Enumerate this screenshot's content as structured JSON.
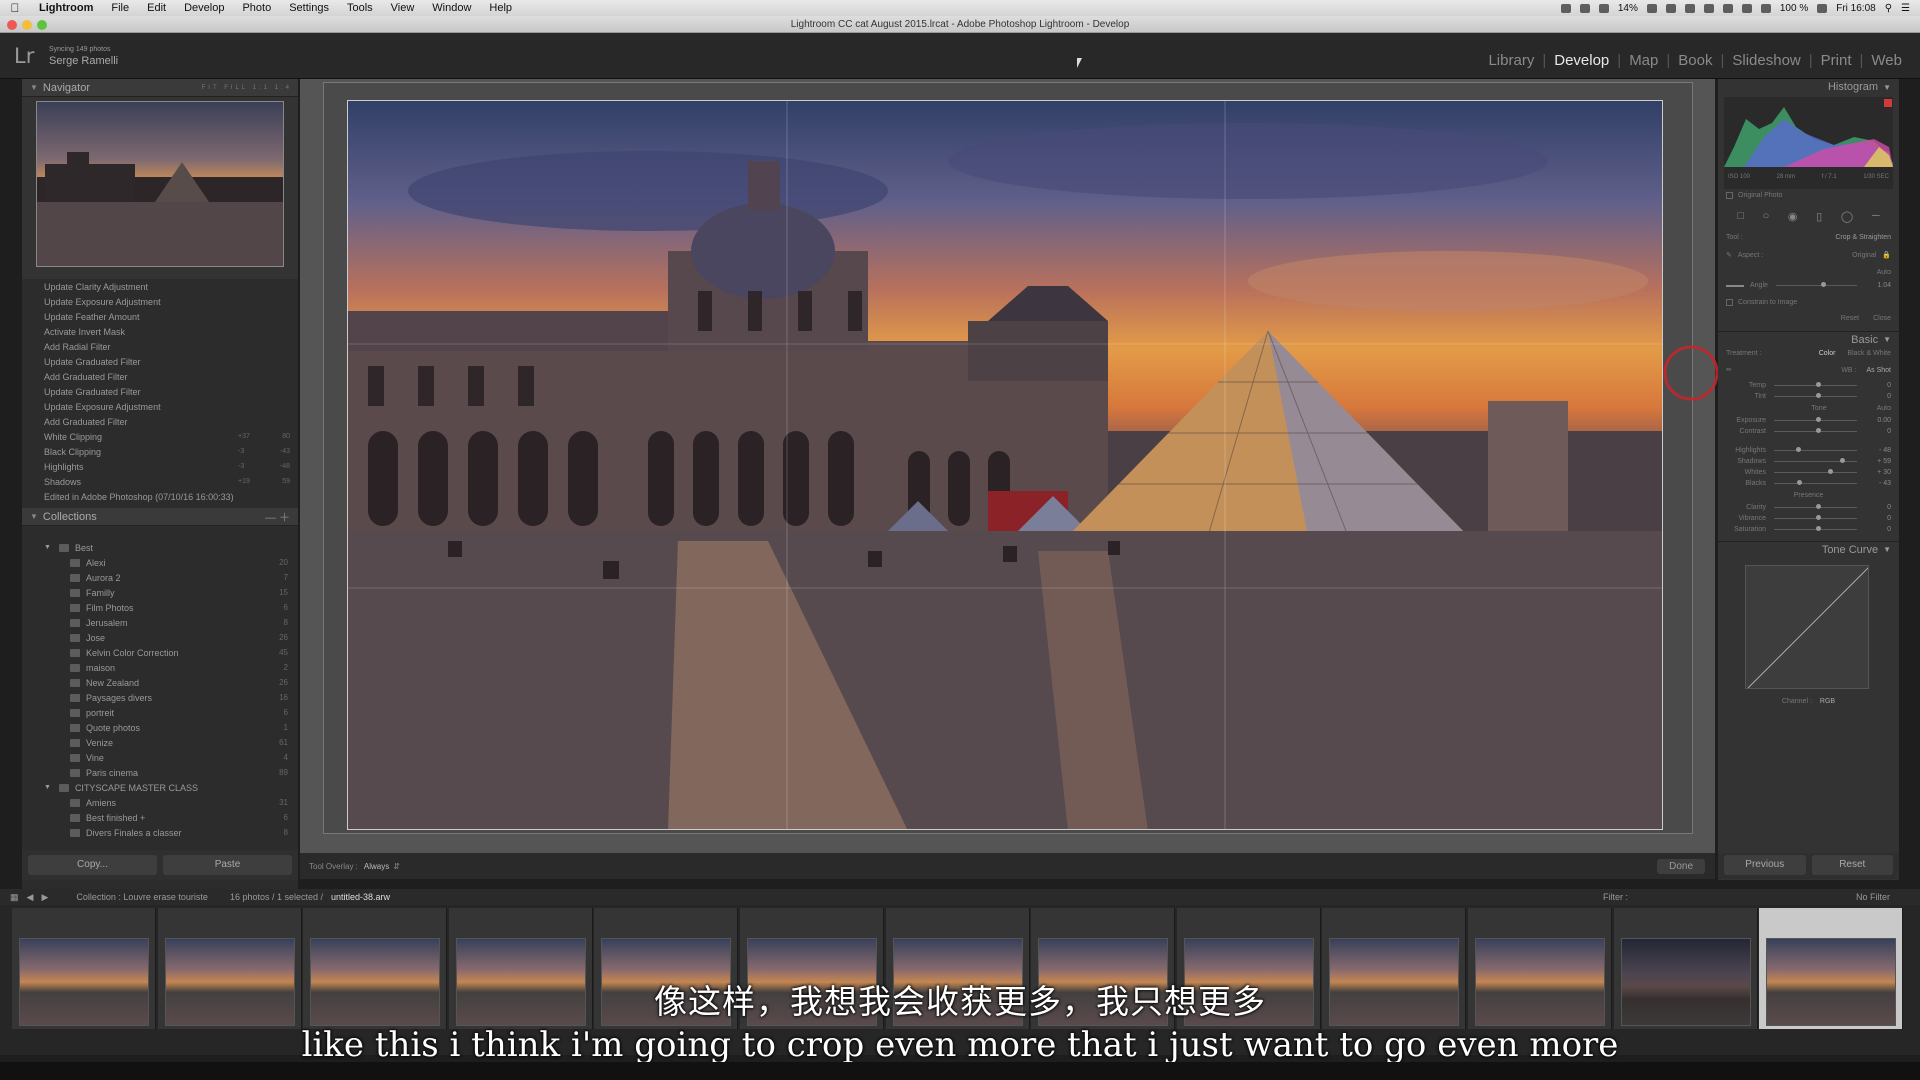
{
  "menubar": {
    "app": "Lightroom",
    "items": [
      "File",
      "Edit",
      "Develop",
      "Photo",
      "Settings",
      "Tools",
      "View",
      "Window",
      "Help"
    ],
    "battery": "14%",
    "battery2": "100 %",
    "clock": "Fri 16:08"
  },
  "window": {
    "title": "Lightroom CC cat August 2015.lrcat - Adobe Photoshop Lightroom - Develop"
  },
  "identity": {
    "logo": "Lr",
    "sync": "Syncing 149 photos",
    "user": "Serge Ramelli",
    "modules": [
      "Library",
      "Develop",
      "Map",
      "Book",
      "Slideshow",
      "Print",
      "Web"
    ],
    "active": "Develop"
  },
  "left": {
    "navigator_title": "Navigator",
    "navigator_opts": "FIT FILL 1:1 1:4",
    "history": [
      "Update Clarity Adjustment",
      "Update Exposure Adjustment",
      "Update Feather Amount",
      "Activate Invert Mask",
      "Add Radial Filter",
      "Update Graduated Filter",
      "Add Graduated Filter",
      "Update Graduated Filter",
      "Update Exposure Adjustment",
      "Add Graduated Filter",
      "White Clipping",
      "Black Clipping",
      "Highlights",
      "Shadows",
      "Edited in Adobe Photoshop (07/10/16 16:00:33)"
    ],
    "history_values": [
      {
        "a": "+37",
        "b": "80"
      },
      {
        "a": "-3",
        "b": "-43"
      },
      {
        "a": "-3",
        "b": "-48"
      },
      {
        "a": "+19",
        "b": "59"
      }
    ],
    "collections_title": "Collections",
    "collections": [
      {
        "name": "Best",
        "count": "",
        "level": 1
      },
      {
        "name": "Alexi",
        "count": "20",
        "level": 2
      },
      {
        "name": "Aurora 2",
        "count": "7",
        "level": 2
      },
      {
        "name": "Familly",
        "count": "15",
        "level": 2
      },
      {
        "name": "Film Photos",
        "count": "6",
        "level": 2
      },
      {
        "name": "Jerusalem",
        "count": "8",
        "level": 2
      },
      {
        "name": "Jose",
        "count": "26",
        "level": 2
      },
      {
        "name": "Kelvin Color Correction",
        "count": "45",
        "level": 2
      },
      {
        "name": "maison",
        "count": "2",
        "level": 2
      },
      {
        "name": "New Zealand",
        "count": "26",
        "level": 2
      },
      {
        "name": "Paysages divers",
        "count": "16",
        "level": 2
      },
      {
        "name": "portreit",
        "count": "6",
        "level": 2
      },
      {
        "name": "Quote photos",
        "count": "1",
        "level": 2
      },
      {
        "name": "Venize",
        "count": "61",
        "level": 2
      },
      {
        "name": "Vine",
        "count": "4",
        "level": 2
      },
      {
        "name": "Paris cinema",
        "count": "89",
        "level": 2
      },
      {
        "name": "CITYSCAPE MASTER CLASS",
        "count": "",
        "level": 1
      },
      {
        "name": "Amiens",
        "count": "31",
        "level": 2
      },
      {
        "name": "Best finished +",
        "count": "6",
        "level": 2
      },
      {
        "name": "Divers Finales a classer",
        "count": "8",
        "level": 2
      }
    ],
    "copy": "Copy...",
    "paste": "Paste"
  },
  "center": {
    "tool_overlay_label": "Tool Overlay :",
    "tool_overlay_value": "Always",
    "done": "Done"
  },
  "right": {
    "histogram": "Histogram",
    "histo_info": [
      "ISO 100",
      "28 mm",
      "f / 7.1",
      "1/30 SEC"
    ],
    "original_photo": "Original Photo",
    "tool_label": "Tool :",
    "tool_value": "Crop & Straighten",
    "aspect_label": "Aspect :",
    "aspect_value": "Original",
    "auto": "Auto",
    "angle_label": "Angle",
    "angle_value": "1.04",
    "constrain": "Constrain to Image",
    "reset": "Reset",
    "close": "Close",
    "basic": "Basic",
    "treatment": "Treatment :",
    "color": "Color",
    "bw": "Black & White",
    "wb": "WB :",
    "wb_value": "As Shot",
    "tone": "Tone",
    "presence": "Presence",
    "sliders": [
      {
        "label": "Temp",
        "value": "0",
        "pos": 0.5
      },
      {
        "label": "Tint",
        "value": "0",
        "pos": 0.5
      },
      {
        "label": "Exposure",
        "value": "0.00",
        "pos": 0.5
      },
      {
        "label": "Contrast",
        "value": "0",
        "pos": 0.5
      },
      {
        "label": "Highlights",
        "value": "- 48",
        "pos": 0.26
      },
      {
        "label": "Shadows",
        "value": "+ 59",
        "pos": 0.8
      },
      {
        "label": "Whites",
        "value": "+ 30",
        "pos": 0.65
      },
      {
        "label": "Blacks",
        "value": "- 43",
        "pos": 0.28
      },
      {
        "label": "Clarity",
        "value": "0",
        "pos": 0.5
      },
      {
        "label": "Vibrance",
        "value": "0",
        "pos": 0.5
      },
      {
        "label": "Saturation",
        "value": "0",
        "pos": 0.5
      }
    ],
    "tone_curve": "Tone Curve",
    "channel_label": "Channel :",
    "channel_value": "RGB",
    "previous": "Previous",
    "reset_btn": "Reset"
  },
  "filmbar": {
    "collection": "Collection : Louvre erase touriste",
    "photos": "16 photos / 1 selected /",
    "file": "untitled-38.arw",
    "filter": "Filter :",
    "no_filter": "No Filter"
  },
  "subtitle": {
    "cn": "像这样，我想我会收获更多，我只想更多",
    "en": "like this i think i'm going to crop even more that i just want to go even more"
  }
}
